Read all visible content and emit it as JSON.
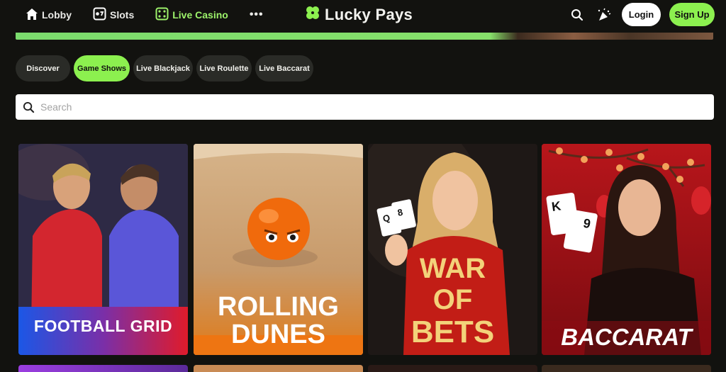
{
  "nav": {
    "items": [
      {
        "label": "Lobby",
        "icon": "home-icon",
        "active": false
      },
      {
        "label": "Slots",
        "icon": "slots-icon",
        "active": false
      },
      {
        "label": "Live Casino",
        "icon": "dice-icon",
        "active": true
      }
    ],
    "more_label": "•••"
  },
  "brand": {
    "name": "Lucky Pays",
    "logo_icon": "clover-icon",
    "color": "#8cf04f"
  },
  "actions": {
    "login_label": "Login",
    "signup_label": "Sign Up"
  },
  "tabs": [
    {
      "label": "Discover",
      "active": false
    },
    {
      "label": "Game Shows",
      "active": true
    },
    {
      "label": "Live Blackjack",
      "active": false
    },
    {
      "label": "Live Roulette",
      "active": false
    },
    {
      "label": "Live Baccarat",
      "active": false
    }
  ],
  "search": {
    "placeholder": "Search"
  },
  "games": [
    {
      "title": "FOOTBALL GRID"
    },
    {
      "title": "ROLLING DUNES",
      "title_line1": "ROLLING",
      "title_line2": "DUNES"
    },
    {
      "title": "WAR OF BETS",
      "title_line1": "WAR",
      "title_line2": "OF",
      "title_line3": "BETS"
    },
    {
      "title": "BACCARAT"
    }
  ],
  "colors": {
    "accent": "#8cf04f",
    "background": "#12120f",
    "tab_bg": "#2a2b27"
  }
}
